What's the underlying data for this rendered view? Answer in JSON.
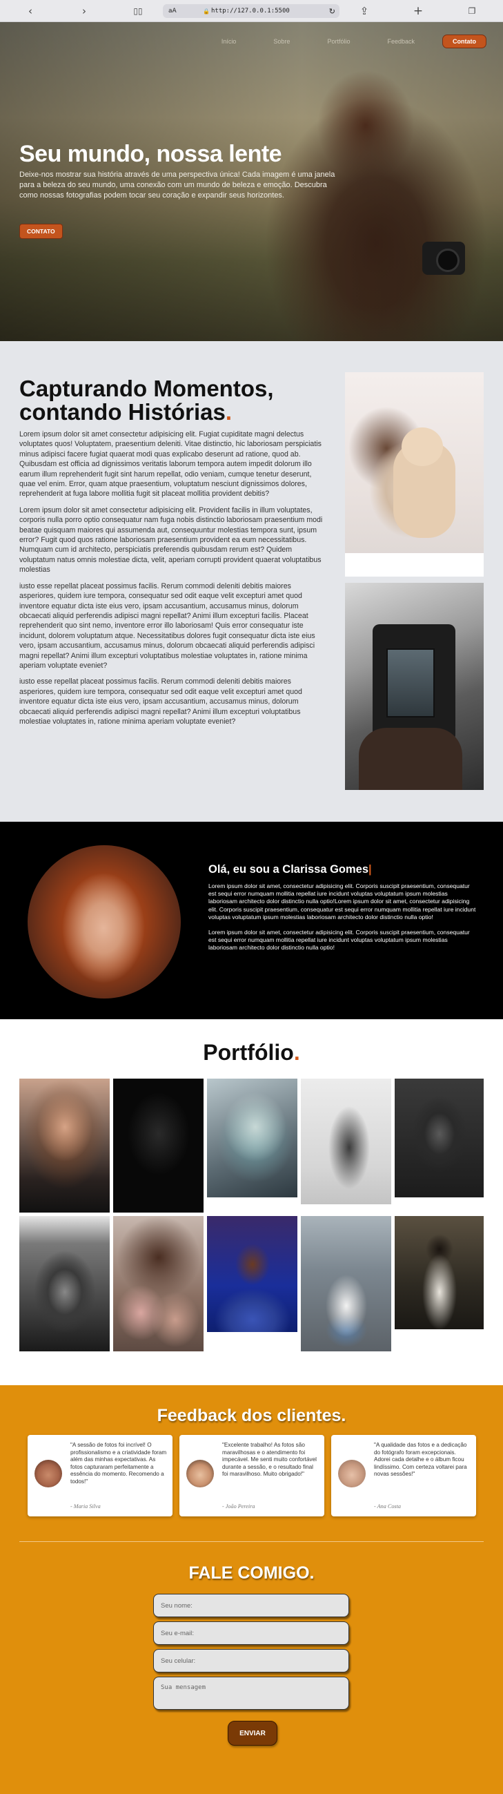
{
  "browser": {
    "text_size_label": "aA",
    "url": "http://127.0.0.1:5500"
  },
  "nav": {
    "items": [
      {
        "label": "Início"
      },
      {
        "label": "Sobre"
      },
      {
        "label": "Portfólio"
      },
      {
        "label": "Feedback"
      }
    ],
    "cta_label": "Contato"
  },
  "hero": {
    "title": "Seu mundo, nossa lente",
    "text": "Deixe-nos mostrar sua história através de uma perspectiva única! Cada imagem é uma janela para a beleza do seu mundo, uma conexão com um mundo de beleza e emoção. Descubra como nossas fotografias podem tocar seu coração e expandir seus horizontes.",
    "button_label": "CONTATO"
  },
  "about": {
    "title": "Capturando Momentos, contando Histórias",
    "title_dot": ".",
    "paragraphs": [
      "Lorem ipsum dolor sit amet consectetur adipisicing elit. Fugiat cupiditate magni delectus voluptates quos! Voluptatem, praesentium deleniti. Vitae distinctio, hic laboriosam perspiciatis minus adipisci facere fugiat quaerat modi quas explicabo deserunt ad ratione, quod ab. Quibusdam est officia ad dignissimos veritatis laborum tempora autem impedit dolorum illo earum illum reprehenderit fugit sint harum repellat, odio veniam, cumque tenetur deserunt, quae vel enim. Error, quam atque praesentium, voluptatum nesciunt dignissimos dolores, reprehenderit at fuga labore mollitia fugit sit placeat mollitia provident debitis?",
      "Lorem ipsum dolor sit amet consectetur adipisicing elit. Provident facilis in illum voluptates, corporis nulla porro optio consequatur nam fuga nobis distinctio laboriosam praesentium modi beatae quisquam maiores qui assumenda aut, consequuntur molestias tempora sunt, ipsum error? Fugit quod quos ratione laboriosam praesentium provident ea eum necessitatibus. Numquam cum id architecto, perspiciatis preferendis quibusdam rerum est? Quidem voluptatum natus omnis molestiae dicta, velit, aperiam corrupti provident quaerat voluptatibus molestias",
      "iusto esse repellat placeat possimus facilis. Rerum commodi deleniti debitis maiores asperiores, quidem iure tempora, consequatur sed odit eaque velit excepturi amet quod inventore equatur dicta iste eius vero, ipsam accusantium, accusamus minus, dolorum obcaecati aliquid perferendis adipisci magni repellat? Animi illum excepturi facilis. Placeat reprehenderit quo sint nemo, inventore error illo laboriosam! Quis error consequatur iste incidunt, dolorem voluptatum atque. Necessitatibus dolores fugit consequatur dicta iste eius vero, ipsam accusantium, accusamus minus, dolorum obcaecati aliquid perferendis adipisci magni repellat? Animi illum excepturi voluptatibus molestiae voluptates in, ratione minima aperiam voluptate eveniet?",
      "iusto esse repellat placeat possimus facilis. Rerum commodi deleniti debitis maiores asperiores, quidem iure tempora, consequatur sed odit eaque velit excepturi amet quod inventore equatur dicta iste eius vero, ipsam accusantium, accusamus minus, dolorum obcaecati aliquid perferendis adipisci magni repellat? Animi illum excepturi voluptatibus molestiae voluptates in, ratione minima aperiam voluptate eveniet?"
    ]
  },
  "intro": {
    "title": "Olá, eu sou a Clarissa Gomes",
    "title_bar": "|",
    "paragraphs": [
      "Lorem ipsum dolor sit amet, consectetur adipisicing elit. Corporis suscipit praesentium, consequatur est sequi error numquam mollitia repellat iure incidunt voluptas voluptatum ipsum molestias laboriosam architecto dolor distinctio nulla optio!Lorem ipsum dolor sit amet, consectetur adipisicing elit. Corporis suscipit praesentium, consequatur est sequi error numquam mollitia repellat iure incidunt voluptas voluptatum ipsum molestias laboriosam architecto dolor distinctio nulla optio!",
      "Lorem ipsum dolor sit amet, consectetur adipisicing elit. Corporis suscipit praesentium, consequatur est sequi error numquam mollitia repellat iure incidunt voluptas voluptatum ipsum molestias laboriosam architecto dolor distinctio nulla optio!"
    ]
  },
  "portfolio": {
    "title": "Portfólio",
    "title_dot": "."
  },
  "feedback": {
    "title": "Feedback dos clientes",
    "title_dot": ".",
    "cards": [
      {
        "quote": "\"A sessão de fotos foi incrível! O profissionalismo e a criatividade foram além das minhas expectativas. As fotos capturaram perfeitamente a essência do momento. Recomendo a todos!\"",
        "author": "- Maria Silva"
      },
      {
        "quote": "\"Excelente trabalho! As fotos são maravilhosas e o atendimento foi impecável. Me senti muito confortável durante a sessão, e o resultado final foi maravilhoso. Muito obrigado!\"",
        "author": "- João Pereira"
      },
      {
        "quote": "\"A qualidade das fotos e a dedicação do fotógrafo foram excepcionais. Adorei cada detalhe e o álbum ficou lindíssimo. Com certeza voltarei para novas sessões!\"",
        "author": "- Ana Costa"
      }
    ]
  },
  "contact": {
    "title": "FALE COMIGO",
    "title_dot": ".",
    "name_placeholder": "Seu nome:",
    "email_placeholder": "Seu e-mail:",
    "phone_placeholder": "Seu celular:",
    "message_placeholder": "Sua mensagem",
    "send_label": "ENVIAR"
  },
  "colors": {
    "accent": "#c3541d",
    "feedback_bg": "#e08f0c",
    "dark_bg": "#000000"
  }
}
